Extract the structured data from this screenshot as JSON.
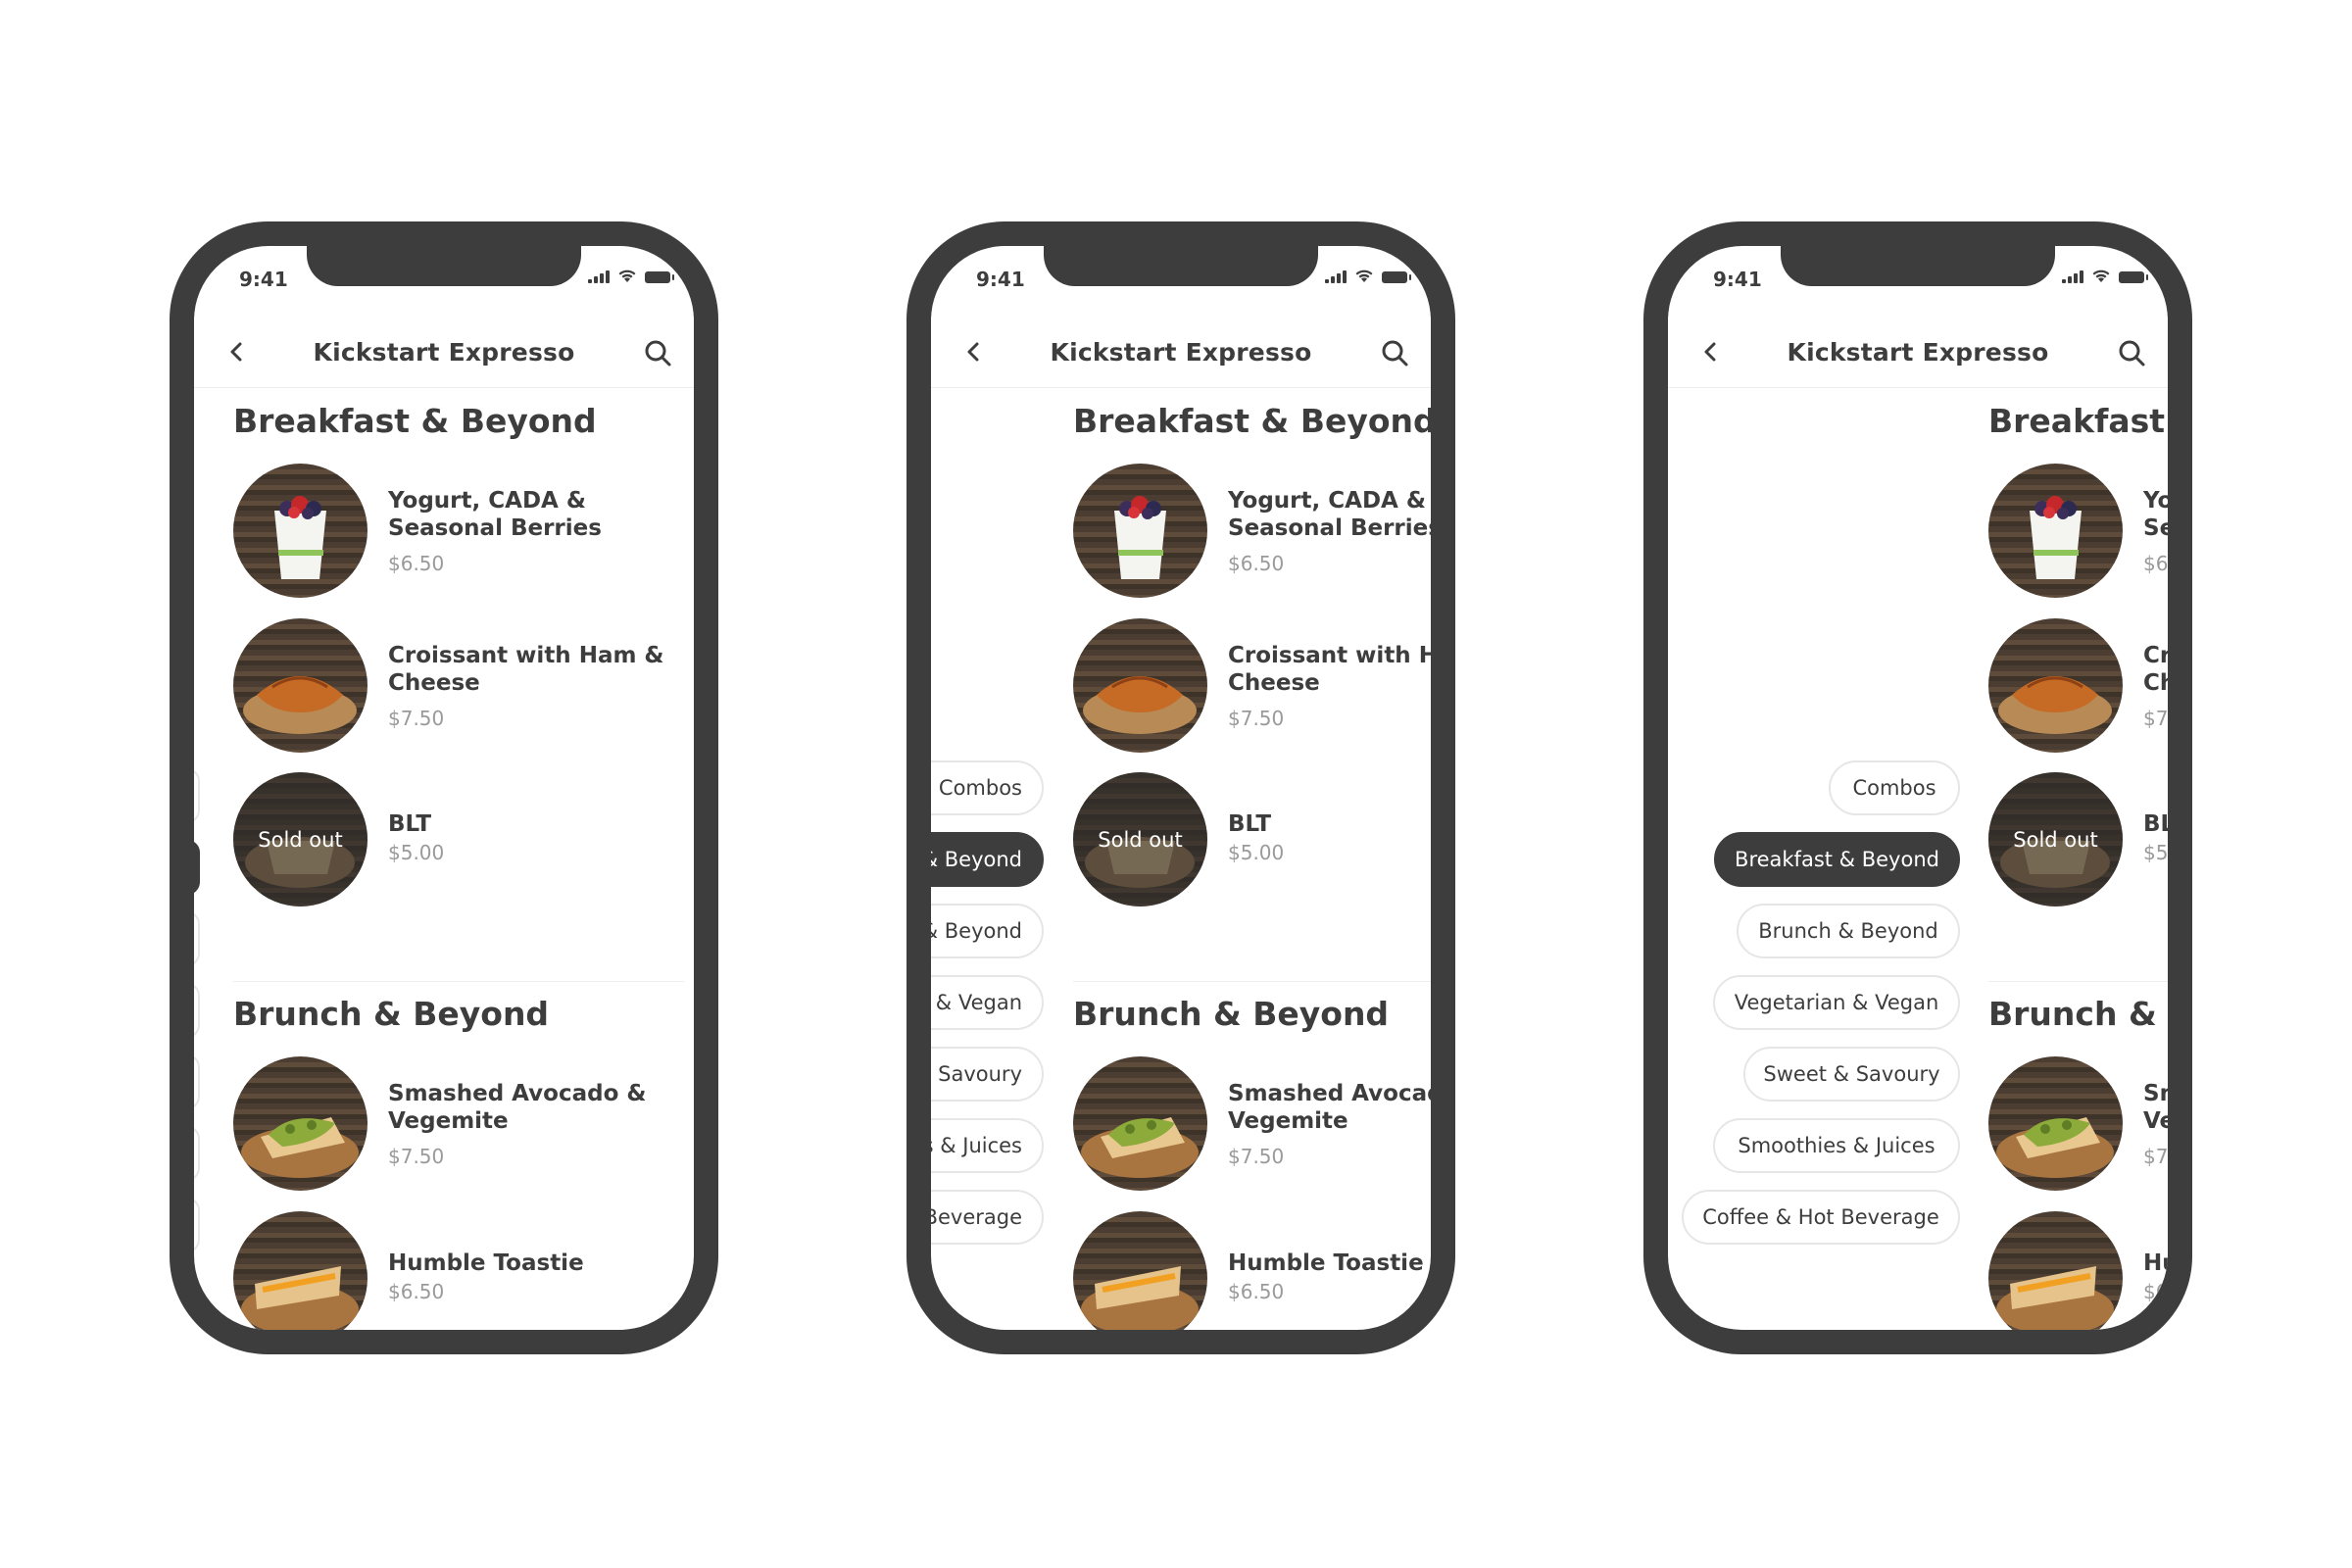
{
  "status": {
    "time": "9:41"
  },
  "nav": {
    "title": "Kickstart Expresso"
  },
  "sections": [
    {
      "title": "Breakfast & Beyond",
      "items": [
        {
          "name_line1": "Yogurt, CADA &",
          "name_line2": "Seasonal Berries",
          "price": "$6.50",
          "image": "yogurt-berries"
        },
        {
          "name_line1": "Croissant with Ham &",
          "name_line2": "Cheese",
          "price": "$7.50",
          "image": "croissant"
        },
        {
          "name_line1": "BLT",
          "name_line2": "",
          "price": "$5.00",
          "image": "blt",
          "badge": "Sold out"
        }
      ]
    },
    {
      "title": "Brunch & Beyond",
      "items": [
        {
          "name_line1": "Smashed Avocado &",
          "name_line2": "Vegemite",
          "price": "$7.50",
          "image": "avocado-toast"
        },
        {
          "name_line1": "Humble Toastie",
          "name_line2": "",
          "price": "$6.50",
          "image": "toastie"
        }
      ]
    }
  ],
  "categories": {
    "active_index": 1,
    "items": [
      "Combos",
      "Breakfast & Beyond",
      "Brunch & Beyond",
      "Vegetarian & Vegan",
      "Sweet & Savoury",
      "Smoothies & Juices",
      "Coffee & Hot Beverage"
    ]
  },
  "colors": {
    "dark": "#3d3d3d",
    "muted": "#9a9a9a",
    "chip_border": "#e6e6e6",
    "background": "#ffffff"
  }
}
